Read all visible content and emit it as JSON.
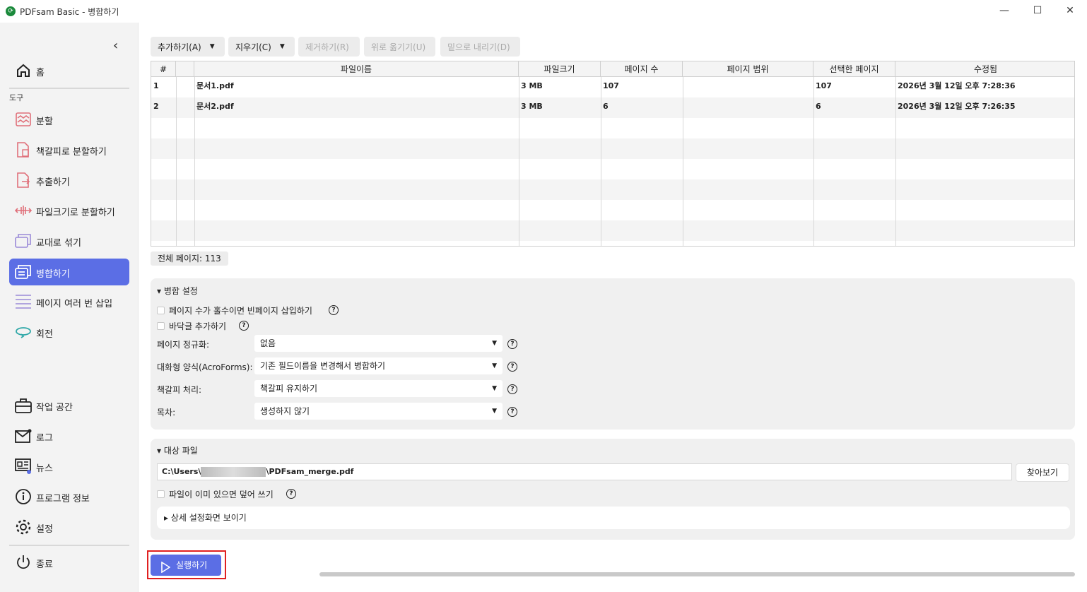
{
  "window": {
    "title": "PDFsam Basic - 병합하기",
    "logo": "pdfsam-logo-icon"
  },
  "sidebar": {
    "section_tools": "도구",
    "items": [
      {
        "label": "홈",
        "icon": "home-icon"
      },
      {
        "label": "분할",
        "icon": "split-icon"
      },
      {
        "label": "책갈피로 분할하기",
        "icon": "split-bookmarks-icon"
      },
      {
        "label": "추출하기",
        "icon": "extract-icon"
      },
      {
        "label": "파일크기로 분할하기",
        "icon": "split-size-icon"
      },
      {
        "label": "교대로 섞기",
        "icon": "alternate-mix-icon"
      },
      {
        "label": "병합하기",
        "icon": "merge-icon",
        "active": true
      },
      {
        "label": "페이지 여러 번 삽입",
        "icon": "insert-pages-icon"
      },
      {
        "label": "회전",
        "icon": "rotate-icon"
      },
      {
        "label": "작업 공간",
        "icon": "workspace-icon"
      },
      {
        "label": "로그",
        "icon": "log-icon"
      },
      {
        "label": "뉴스",
        "icon": "news-icon"
      },
      {
        "label": "프로그램 정보",
        "icon": "info-icon"
      },
      {
        "label": "설정",
        "icon": "settings-icon"
      },
      {
        "label": "종료",
        "icon": "power-icon"
      }
    ]
  },
  "toolbar": {
    "add": "추가하기(A)",
    "clear": "지우기(C)",
    "remove": "제거하기(R)",
    "move_up": "위로 옮기기(U)",
    "move_down": "밑으로 내리기(D)"
  },
  "table": {
    "headers": [
      "#",
      "",
      "파일이름",
      "파일크기",
      "페이지 수",
      "페이지 범위",
      "선택한 페이지",
      "수정됨"
    ],
    "rows": [
      {
        "num": "1",
        "name": "문서1.pdf",
        "size": "3 MB",
        "pages": "107",
        "range": "",
        "selected": "107",
        "modified": "2026년 3월 12일 오후 7:28:36"
      },
      {
        "num": "2",
        "name": "문서2.pdf",
        "size": "3 MB",
        "pages": "6",
        "range": "",
        "selected": "6",
        "modified": "2026년 3월 12일 오후 7:26:35"
      }
    ]
  },
  "total_pages": "전체 페이지: 113",
  "merge_settings": {
    "header": "병합 설정",
    "blank_page": "페이지 수가 홀수이면 빈페이지 삽입하기",
    "footer": "바닥글 추가하기",
    "normalize_label": "페이지 정규화:",
    "normalize_value": "없음",
    "forms_label": "대화형 양식(AcroForms):",
    "forms_value": "기존 필드이름을 변경해서 병합하기",
    "bookmarks_label": "책갈피 처리:",
    "bookmarks_value": "책갈피 유지하기",
    "toc_label": "목차:",
    "toc_value": "생성하지 않기"
  },
  "destination": {
    "header": "대상 파일",
    "path_prefix": "C:\\Users\\",
    "path_suffix": "\\PDFsam_merge.pdf",
    "browse": "찾아보기",
    "overwrite": "파일이 이미 있으면 덮어 쓰기",
    "advanced": "상세 설정화면 보이기"
  },
  "run_button": "실행하기",
  "colors": {
    "accent": "#5b6ee5",
    "highlight_frame": "#e02020"
  }
}
